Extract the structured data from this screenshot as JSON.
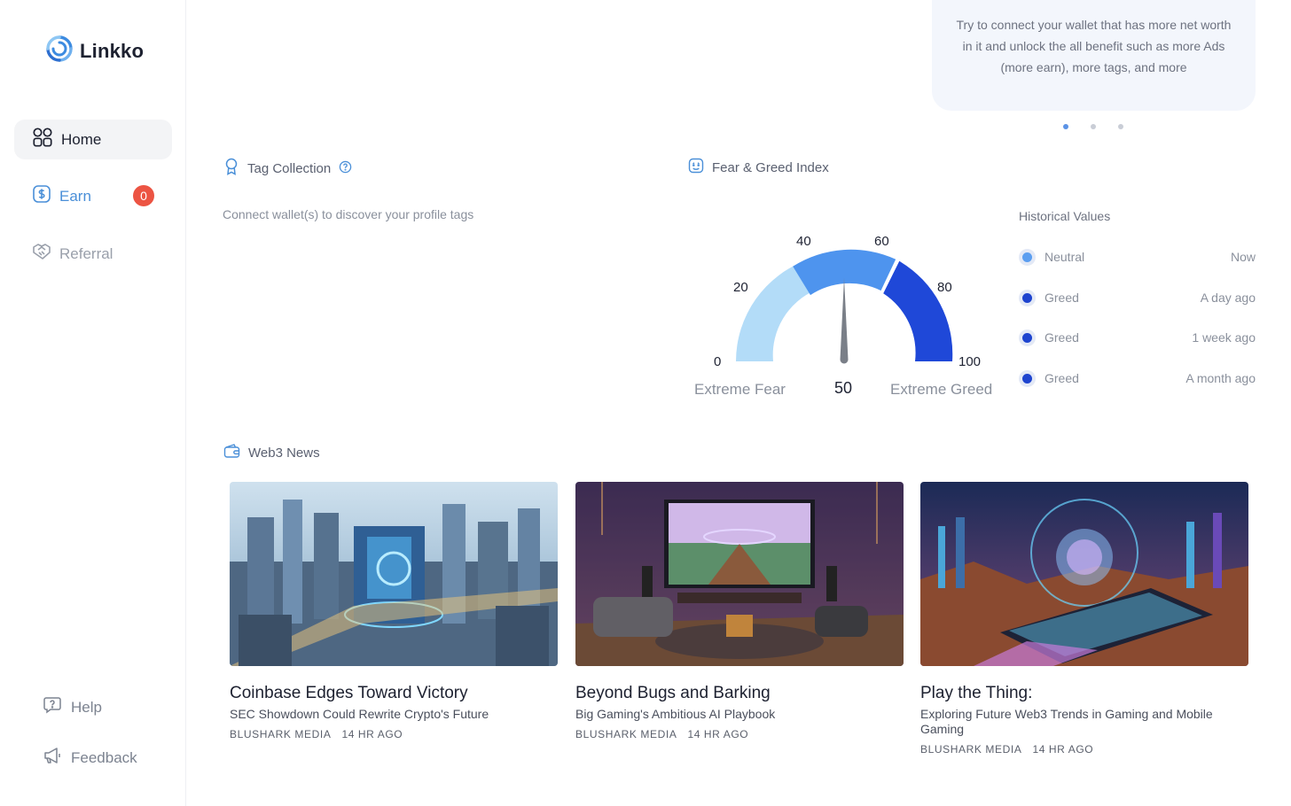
{
  "brand": {
    "name": "Linkko",
    "accent": "#4a8fd8"
  },
  "sidebar": {
    "items": [
      {
        "label": "Home",
        "icon": "grid-icon",
        "active": true
      },
      {
        "label": "Earn",
        "icon": "dollar-icon",
        "badge": "0"
      },
      {
        "label": "Referral",
        "icon": "handshake-icon"
      }
    ],
    "bottom": [
      {
        "label": "Help",
        "icon": "help-chat-icon"
      },
      {
        "label": "Feedback",
        "icon": "megaphone-icon"
      }
    ]
  },
  "promo": {
    "text": "Try to connect your wallet that has more net worth in it and unlock the all benefit such as more Ads (more earn), more tags, and more",
    "slides": 3,
    "active_slide": 0
  },
  "tag_collection": {
    "title": "Tag Collection",
    "empty_text": "Connect wallet(s) to discover your profile tags"
  },
  "fear_greed": {
    "title": "Fear & Greed Index",
    "value": "50",
    "scale_labels": [
      "0",
      "20",
      "40",
      "60",
      "80",
      "100"
    ],
    "left_label": "Extreme Fear",
    "right_label": "Extreme Greed",
    "colors": [
      "#b3dcf8",
      "#4e94ee",
      "#1f48d8"
    ],
    "historical_title": "Historical Values",
    "historical": [
      {
        "label": "Neutral",
        "time": "Now",
        "color": "#5b9ef0"
      },
      {
        "label": "Greed",
        "time": "A day ago",
        "color": "#1e44cf"
      },
      {
        "label": "Greed",
        "time": "1 week ago",
        "color": "#1e44cf"
      },
      {
        "label": "Greed",
        "time": "A month ago",
        "color": "#1e44cf"
      }
    ]
  },
  "news": {
    "title": "Web3 News",
    "items": [
      {
        "title": "Coinbase Edges Toward Victory",
        "subtitle": "SEC Showdown Could Rewrite Crypto's Future",
        "source": "BLUSHARK MEDIA",
        "time": "14 HR AGO",
        "image": "city-crypto-image"
      },
      {
        "title": "Beyond Bugs and Barking",
        "subtitle": "Big Gaming's Ambitious AI Playbook",
        "source": "BLUSHARK MEDIA",
        "time": "14 HR AGO",
        "image": "gaming-room-image"
      },
      {
        "title": "Play the Thing:",
        "subtitle": "Exploring Future Web3 Trends in Gaming and Mobile Gaming",
        "source": "BLUSHARK MEDIA",
        "time": "14 HR AGO",
        "image": "mobile-gaming-image"
      }
    ]
  }
}
